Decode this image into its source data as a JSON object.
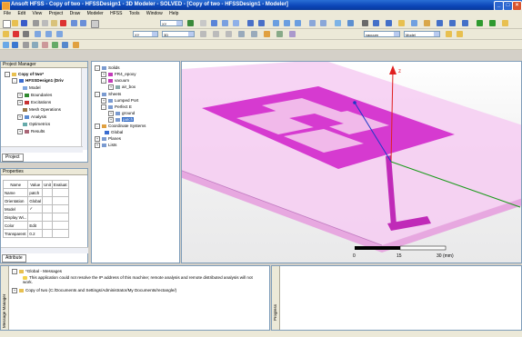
{
  "window": {
    "title": "Ansoft HFSS - Copy of two - HFSSDesign1 - 3D Modeler - SOLVED - [Copy of two - HFSSDesign1 - Modeler]",
    "buttons": [
      "_",
      "□",
      "×"
    ]
  },
  "menu": [
    "File",
    "Edit",
    "View",
    "Project",
    "Draw",
    "Modeler",
    "HFSS",
    "Tools",
    "Window",
    "Help"
  ],
  "toolbar": {
    "view_select": "XY",
    "dim_select": "3D",
    "material_select": "vacuum",
    "model_select": "Model"
  },
  "project_manager": {
    "title": "Project Manager",
    "items": [
      "Copy of two*",
      "HFSSDesign1 (Driv",
      "Model",
      "Boundaries",
      "Excitations",
      "Mesh Operations",
      "Analysis",
      "Optimetrics",
      "Results"
    ],
    "tab": "Project"
  },
  "model_tree": {
    "items": [
      "Solids",
      "FR4_epoxy",
      "vacuum",
      "air_box",
      "Sheets",
      "Lumped Port",
      "Perfect E",
      "ground",
      "patch",
      "Coordinate Systems",
      "Global",
      "Planes",
      "Lists"
    ]
  },
  "properties": {
    "title": "Properties",
    "headers": [
      "Name",
      "Value",
      "Unit",
      "Evaluat"
    ],
    "rows": [
      {
        "name": "Name",
        "value": "patch"
      },
      {
        "name": "Orientation",
        "value": "Global"
      },
      {
        "name": "Model",
        "value": "✓"
      },
      {
        "name": "Display Wi...",
        "value": ""
      },
      {
        "name": "Color",
        "value": "Edit"
      },
      {
        "name": "Transparent",
        "value": "0.2"
      }
    ],
    "tab": "Attribute"
  },
  "viewport": {
    "scale_labels": [
      "0",
      "15",
      "30 (mm)"
    ],
    "axis_labels": {
      "z": "z"
    }
  },
  "messages": {
    "side_label": "Message Manager",
    "root": "*Global - Messages",
    "warning": "This application could not resolve the IP address of this machine; remote analysis and remote distributed analysis will not work.",
    "project_line": "Copy of two (C:/Documents and Settings/Administrator/My Documents/rectangle/)"
  },
  "progress": {
    "side_label": "Progress"
  },
  "colors": {
    "title_blue": "#0b45b8",
    "patch_magenta": "#d63ad0",
    "substrate_pink": "#f2b7ee"
  }
}
